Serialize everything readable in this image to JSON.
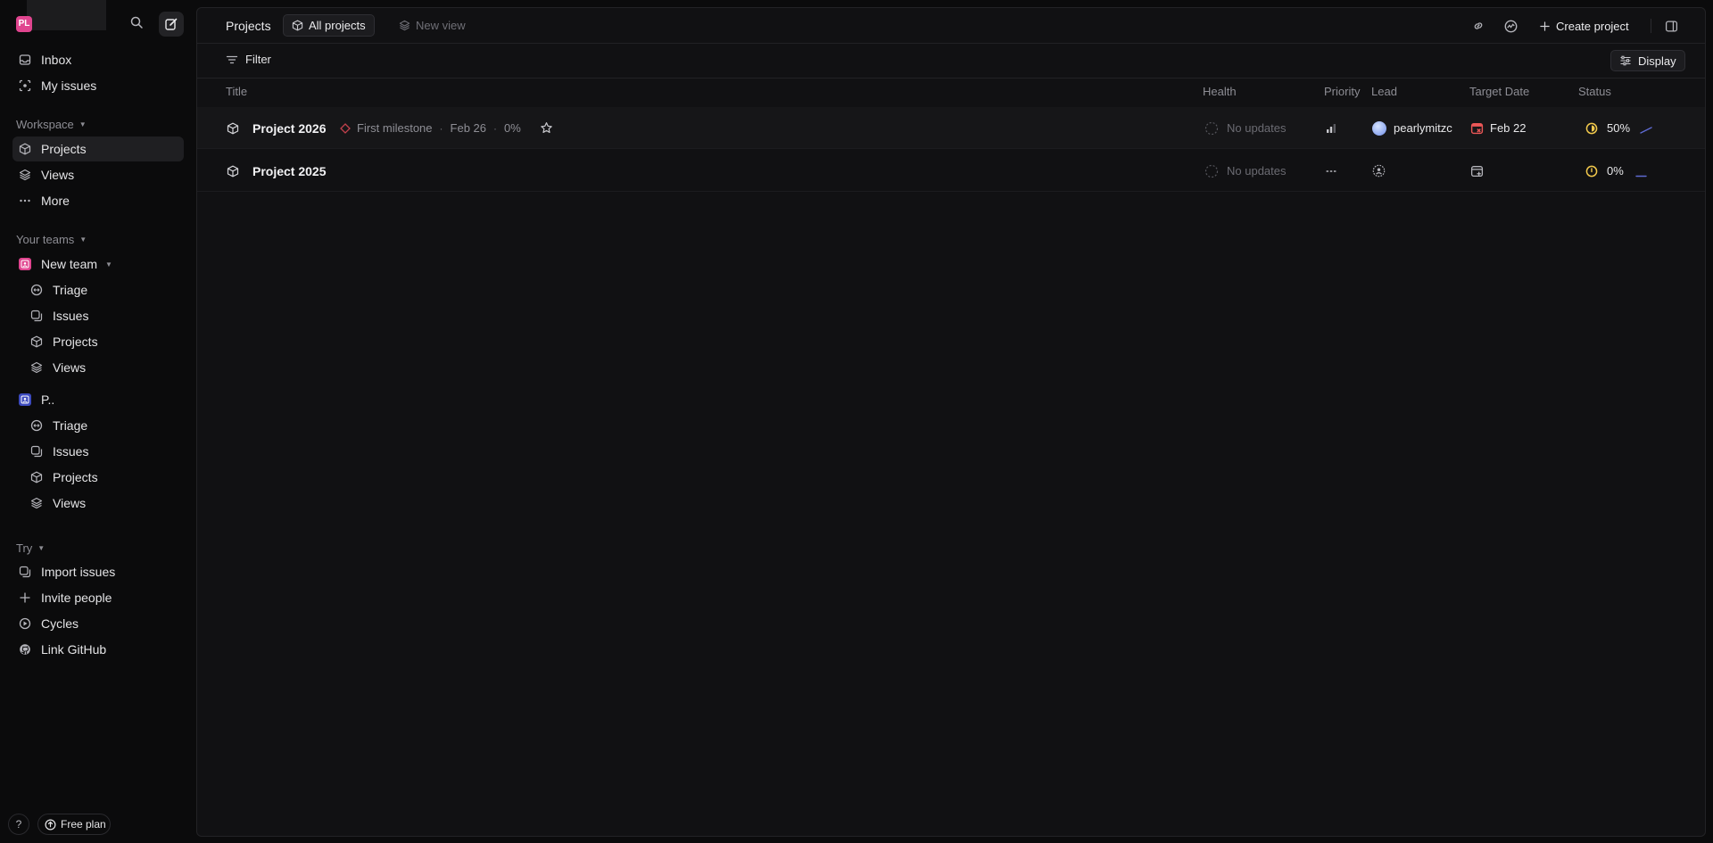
{
  "workspace": {
    "initials": "PL",
    "name": "PL..."
  },
  "sidebar": {
    "top_items": [
      {
        "label": "Inbox",
        "icon": "inbox-icon"
      },
      {
        "label": "My issues",
        "icon": "my-issues-icon"
      }
    ],
    "workspace_section": {
      "title": "Workspace",
      "items": [
        {
          "label": "Projects",
          "icon": "cube-icon",
          "active": true
        },
        {
          "label": "Views",
          "icon": "layers-icon"
        },
        {
          "label": "More",
          "icon": "ellipsis-icon"
        }
      ]
    },
    "teams_section": {
      "title": "Your teams",
      "teams": [
        {
          "name": "New team",
          "color": "#e0458f",
          "items": [
            {
              "label": "Triage"
            },
            {
              "label": "Issues"
            },
            {
              "label": "Projects"
            },
            {
              "label": "Views"
            }
          ]
        },
        {
          "name": "P...",
          "color": "#5a6be0",
          "items": [
            {
              "label": "Triage"
            },
            {
              "label": "Issues"
            },
            {
              "label": "Projects"
            },
            {
              "label": "Views"
            }
          ]
        }
      ]
    },
    "try_section": {
      "title": "Try",
      "items": [
        {
          "label": "Import issues",
          "icon": "import-icon"
        },
        {
          "label": "Invite people",
          "icon": "plus-icon"
        },
        {
          "label": "Cycles",
          "icon": "cycles-icon"
        },
        {
          "label": "Link GitHub",
          "icon": "github-icon"
        }
      ]
    },
    "help_label": "?",
    "plan_label": "Free plan"
  },
  "topbar": {
    "breadcrumb": "Projects",
    "tab_all": "All projects",
    "tab_new": "New view",
    "create_label": "Create project"
  },
  "filterbar": {
    "filter_label": "Filter",
    "display_label": "Display"
  },
  "table": {
    "columns": {
      "title": "Title",
      "health": "Health",
      "priority": "Priority",
      "lead": "Lead",
      "target": "Target Date",
      "status": "Status"
    },
    "rows": [
      {
        "title": "Project 2026",
        "milestone": "First milestone",
        "milestone_date": "Feb 26",
        "milestone_progress": "0%",
        "health": "No updates",
        "priority_icon": "priority-bars-icon",
        "lead": "pearlymitzc",
        "target_date": "Feb 22",
        "target_overdue": true,
        "status": "50%",
        "status_color": "#f2c94c"
      },
      {
        "title": "Project 2025",
        "health": "No updates",
        "priority_icon": "no-priority-icon",
        "lead": "",
        "target_date": "",
        "status": "0%",
        "status_color": "#f2c94c"
      }
    ]
  },
  "colors": {
    "accent": "#5e6ad2",
    "danger": "#eb5757",
    "status": "#f2c94c"
  }
}
